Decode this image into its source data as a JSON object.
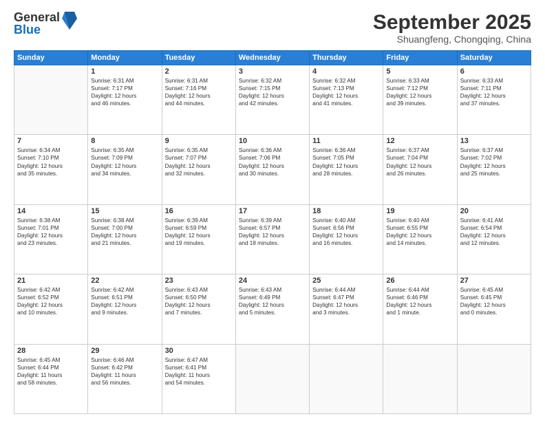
{
  "logo": {
    "general": "General",
    "blue": "Blue"
  },
  "title": "September 2025",
  "location": "Shuangfeng, Chongqing, China",
  "headers": [
    "Sunday",
    "Monday",
    "Tuesday",
    "Wednesday",
    "Thursday",
    "Friday",
    "Saturday"
  ],
  "weeks": [
    [
      {
        "day": "",
        "info": ""
      },
      {
        "day": "1",
        "info": "Sunrise: 6:31 AM\nSunset: 7:17 PM\nDaylight: 12 hours\nand 46 minutes."
      },
      {
        "day": "2",
        "info": "Sunrise: 6:31 AM\nSunset: 7:16 PM\nDaylight: 12 hours\nand 44 minutes."
      },
      {
        "day": "3",
        "info": "Sunrise: 6:32 AM\nSunset: 7:15 PM\nDaylight: 12 hours\nand 42 minutes."
      },
      {
        "day": "4",
        "info": "Sunrise: 6:32 AM\nSunset: 7:13 PM\nDaylight: 12 hours\nand 41 minutes."
      },
      {
        "day": "5",
        "info": "Sunrise: 6:33 AM\nSunset: 7:12 PM\nDaylight: 12 hours\nand 39 minutes."
      },
      {
        "day": "6",
        "info": "Sunrise: 6:33 AM\nSunset: 7:11 PM\nDaylight: 12 hours\nand 37 minutes."
      }
    ],
    [
      {
        "day": "7",
        "info": "Sunrise: 6:34 AM\nSunset: 7:10 PM\nDaylight: 12 hours\nand 35 minutes."
      },
      {
        "day": "8",
        "info": "Sunrise: 6:35 AM\nSunset: 7:09 PM\nDaylight: 12 hours\nand 34 minutes."
      },
      {
        "day": "9",
        "info": "Sunrise: 6:35 AM\nSunset: 7:07 PM\nDaylight: 12 hours\nand 32 minutes."
      },
      {
        "day": "10",
        "info": "Sunrise: 6:36 AM\nSunset: 7:06 PM\nDaylight: 12 hours\nand 30 minutes."
      },
      {
        "day": "11",
        "info": "Sunrise: 6:36 AM\nSunset: 7:05 PM\nDaylight: 12 hours\nand 28 minutes."
      },
      {
        "day": "12",
        "info": "Sunrise: 6:37 AM\nSunset: 7:04 PM\nDaylight: 12 hours\nand 26 minutes."
      },
      {
        "day": "13",
        "info": "Sunrise: 6:37 AM\nSunset: 7:02 PM\nDaylight: 12 hours\nand 25 minutes."
      }
    ],
    [
      {
        "day": "14",
        "info": "Sunrise: 6:38 AM\nSunset: 7:01 PM\nDaylight: 12 hours\nand 23 minutes."
      },
      {
        "day": "15",
        "info": "Sunrise: 6:38 AM\nSunset: 7:00 PM\nDaylight: 12 hours\nand 21 minutes."
      },
      {
        "day": "16",
        "info": "Sunrise: 6:39 AM\nSunset: 6:59 PM\nDaylight: 12 hours\nand 19 minutes."
      },
      {
        "day": "17",
        "info": "Sunrise: 6:39 AM\nSunset: 6:57 PM\nDaylight: 12 hours\nand 18 minutes."
      },
      {
        "day": "18",
        "info": "Sunrise: 6:40 AM\nSunset: 6:56 PM\nDaylight: 12 hours\nand 16 minutes."
      },
      {
        "day": "19",
        "info": "Sunrise: 6:40 AM\nSunset: 6:55 PM\nDaylight: 12 hours\nand 14 minutes."
      },
      {
        "day": "20",
        "info": "Sunrise: 6:41 AM\nSunset: 6:54 PM\nDaylight: 12 hours\nand 12 minutes."
      }
    ],
    [
      {
        "day": "21",
        "info": "Sunrise: 6:42 AM\nSunset: 6:52 PM\nDaylight: 12 hours\nand 10 minutes."
      },
      {
        "day": "22",
        "info": "Sunrise: 6:42 AM\nSunset: 6:51 PM\nDaylight: 12 hours\nand 9 minutes."
      },
      {
        "day": "23",
        "info": "Sunrise: 6:43 AM\nSunset: 6:50 PM\nDaylight: 12 hours\nand 7 minutes."
      },
      {
        "day": "24",
        "info": "Sunrise: 6:43 AM\nSunset: 6:49 PM\nDaylight: 12 hours\nand 5 minutes."
      },
      {
        "day": "25",
        "info": "Sunrise: 6:44 AM\nSunset: 6:47 PM\nDaylight: 12 hours\nand 3 minutes."
      },
      {
        "day": "26",
        "info": "Sunrise: 6:44 AM\nSunset: 6:46 PM\nDaylight: 12 hours\nand 1 minute."
      },
      {
        "day": "27",
        "info": "Sunrise: 6:45 AM\nSunset: 6:45 PM\nDaylight: 12 hours\nand 0 minutes."
      }
    ],
    [
      {
        "day": "28",
        "info": "Sunrise: 6:45 AM\nSunset: 6:44 PM\nDaylight: 11 hours\nand 58 minutes."
      },
      {
        "day": "29",
        "info": "Sunrise: 6:46 AM\nSunset: 6:42 PM\nDaylight: 11 hours\nand 56 minutes."
      },
      {
        "day": "30",
        "info": "Sunrise: 6:47 AM\nSunset: 6:41 PM\nDaylight: 11 hours\nand 54 minutes."
      },
      {
        "day": "",
        "info": ""
      },
      {
        "day": "",
        "info": ""
      },
      {
        "day": "",
        "info": ""
      },
      {
        "day": "",
        "info": ""
      }
    ]
  ]
}
